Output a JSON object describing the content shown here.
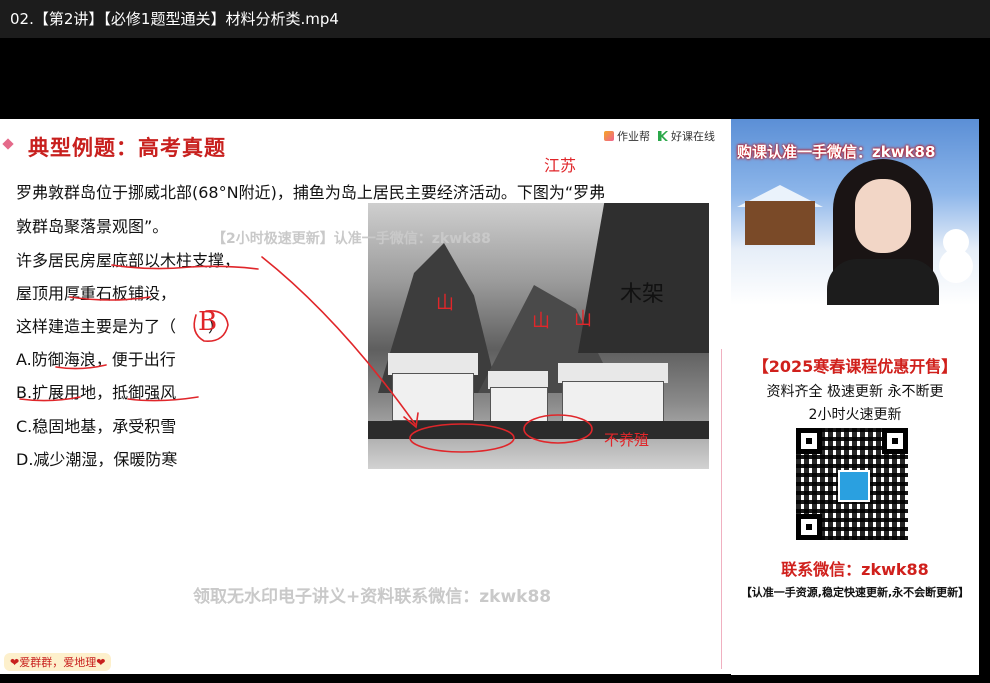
{
  "window": {
    "title": "02.【第2讲】【必修1题型通关】材料分析类.mp4"
  },
  "slide": {
    "heading": "典型例题：高考真题",
    "brand_a": "作业帮",
    "brand_b": "好课在线",
    "question_lines": [
      "罗弗敦群岛位于挪威北部(68°N附近)，捕鱼为岛上居民主要经济活动。下图为“罗弗",
      "敦群岛聚落景观图”。",
      "许多居民房屋底部以木柱支撑，",
      "屋顶用厚重石板铺设，",
      "这样建造主要是为了（　　）",
      "A.防御海浪，便于出行",
      "B.扩展用地，抵御强风",
      "C.稳固地基，承受积雪",
      "D.减少潮湿，保暖防寒"
    ],
    "watermark_top": "【2小时极速更新】认准一手微信：zkwk88",
    "watermark_bottom": "领取无水印电子讲义+资料联系微信：zkwk88",
    "photo_label": "木架",
    "footer_badge": "❤爱群群，爱地理❤",
    "annotations": {
      "answer": "B",
      "mountain_1": "山",
      "mountain_2": "山",
      "mountain_3": "山",
      "top_note": "江苏",
      "bottom_note": "不养殖"
    }
  },
  "webcam": {
    "banner": "购课认准一手微信：zkwk88"
  },
  "ad": {
    "title": "【2025寒春课程优惠开售】",
    "line1": "资料齐全  极速更新 永不断更",
    "line2": "2小时火速更新",
    "contact": "联系微信：zkwk88",
    "footer": "【认准一手资源,稳定快速更新,永不会断更新】"
  },
  "colors": {
    "accent_red": "#c8201e",
    "ink_red": "#e0262a",
    "titlebar": "#1c1c1c"
  }
}
